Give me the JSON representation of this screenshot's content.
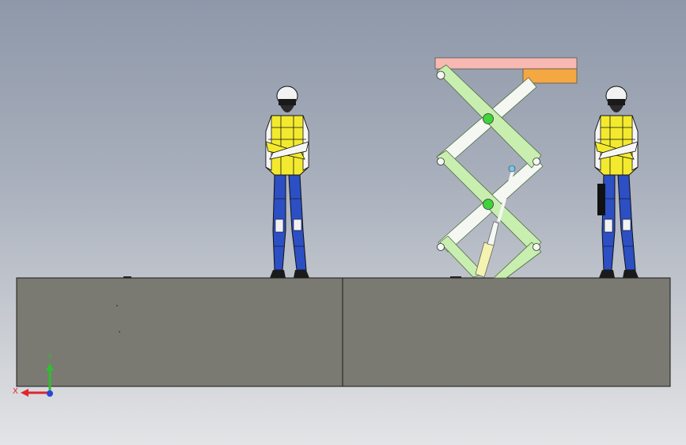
{
  "viewport": {
    "background_top": "#8e98a9",
    "background_bottom": "#e3e4e6"
  },
  "ground": {
    "color": "#7a7a72",
    "outline": "#1a1a1a"
  },
  "lift": {
    "platform_color": "#f7b9b1",
    "block_color": "#f5a742",
    "arm_color": "#c8eeb0",
    "arm_light": "#f4f7f2",
    "pivot_color": "#3fd43a",
    "cylinder_color": "#f4f3b0"
  },
  "workers": {
    "vest_color": "#f3ea2f",
    "pants_color": "#2c4fc4",
    "helmet_color": "#f2f2f2"
  },
  "triad": {
    "x_label": "X",
    "y_label": "Y",
    "x_color": "#e0262a",
    "y_color": "#2fbf30",
    "z_color": "#2a45d8"
  }
}
